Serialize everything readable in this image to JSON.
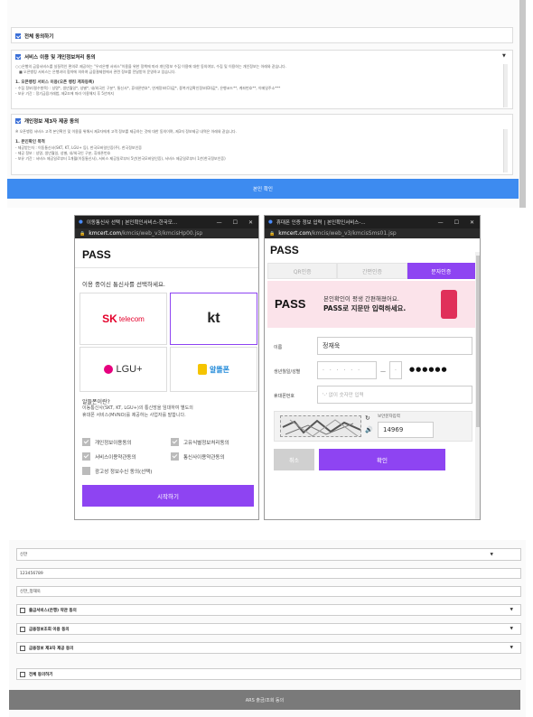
{
  "top": {
    "agree_all": "전체 동의하기",
    "section1_title": "서비스 이용 및 개인정보처리 동의",
    "section1_lines": [
      "○○은행의 금융서비스를 실질적인 편의로 제공하는 \"우리은행 서비스\"이용을 위한 정책에 따라 개인정보 수집 이용에 대한 동의여부, 수집 및 이용하는 개인정보는 아래와 같습니다.",
      "■ 오픈뱅킹 서비스는 은행과의 협약에 의하여 금융결제원에서 관련 정보를 전달받아 운영하고 있습니다."
    ],
    "section1_sub": "1. 오픈뱅킹 서비스 이용(오픈 뱅킹 계좌등록)",
    "section1_items": [
      "- 수집 정보(필수항목) : 성명*, 생년월일*, 성별*, 내/외국인 구분*, 통신사*, 휴대폰번호*, 연계정보(CI)값*, 중복가입확인정보(DI)값*, 은행코드**, 계좌번호**, 이메일주소***",
      "- 보유 기간 : 정기금융거래법, 제2조에 따라 이용해지 후 5년까지"
    ],
    "section2_title": "개인정보 제3자 제공 동의",
    "section2_line": "※ 오픈뱅킹 서비스 고객 본인확인 및 이용을 위해서 제3자에게 고객 정보를 제공하는 것에 대한 동의이며, 제3자 정보제공 내역은 아래와 같습니다.",
    "section2_sub": "1. 본인확인 목적",
    "section2_items": [
      "- 제공받는자 : 이동통신사(SKT, KT, LGU+ 등), 한국모바일인증(주), 한국정보인증",
      "- 제공 정보 : 성명, 생년월일, 성별, 내/외국인 구분, 휴대폰번호",
      "- 보유 기간 : 서비스 제공일로부터 1개월(이동통신사), 서비스 제공일로부터 5년(한국모바일인증), 서비스 제공일로부터 1년(한국정보인증)"
    ],
    "confirm_button": "본인 확인"
  },
  "win1": {
    "title": "이동통신사 선택 | 본인확인서비스-한국모...",
    "controls": [
      "—",
      "☐",
      "✕"
    ],
    "url_host": "kmcert.com",
    "url_path": "/kmcis/web_v3/kmcisHp00.jsp",
    "logo": "PASS",
    "prompt": "이용 중이신 통신사를 선택하세요.",
    "carriers": [
      "SK telecom",
      "kt",
      "LGU+",
      "알뜰폰"
    ],
    "mvno_q": "알뜰폰이란?",
    "mvno_desc": [
      "이동통신사(SKT, KT, LGU+)의 통신망을 임대하여 별도의",
      "휴대폰 서비스(MVNO)를 제공하는 사업자를 말합니다."
    ],
    "agreements": [
      "개인정보이용동의",
      "고유식별정보처리동의",
      "서비스이용약관동의",
      "통신사이용약관동의",
      "광고성 정보수신 동의(선택)"
    ],
    "start_button": "시작하기"
  },
  "win2": {
    "title": "휴대폰 인증 정보 입력 | 본인확인서비스-...",
    "controls": [
      "—",
      "☐",
      "✕"
    ],
    "url_host": "kmcert.com",
    "url_path": "/kmcis/web_v3/kmcisSms01.jsp",
    "logo": "PASS",
    "tabs": [
      "QR인증",
      "간편인증",
      "문자인증"
    ],
    "banner_logo": "PASS",
    "banner_line1": "본인확인이 평생 간편해졌어요.",
    "banner_line2": "PASS로 지문만 입력하세요.",
    "name_label": "이름",
    "name_value": "정재욱",
    "birth_label": "생년월일/성별",
    "birth_value": "· · · · · ·",
    "gender_value": "·",
    "rrn_mask": "●●●●●●",
    "phone_label": "휴대폰번호",
    "phone_placeholder": "'-' 없이 숫자만 입력",
    "captcha_label": "보안문자입력",
    "captcha_value": "14969",
    "cancel_button": "취소",
    "ok_button": "확인"
  },
  "bottom": {
    "bank": "신한",
    "account": "123456789",
    "holder": "신한_정재욱",
    "rows": [
      "출금서비스(은행) 약관 동의",
      "금융정보조회 이용 동의",
      "금융정보 제3자 제공 동의"
    ],
    "agree_all": "전체 동의하기",
    "ars_button": "ARS 출금/조회 동의"
  },
  "colors": {
    "accent_blue": "#3d8bf0",
    "pass_purple": "#8e44f2",
    "banner_pink": "#fbe3ea"
  }
}
